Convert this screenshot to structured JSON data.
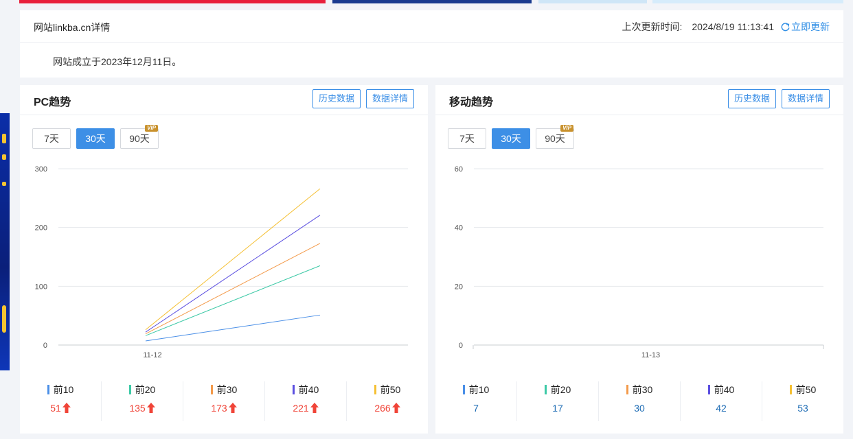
{
  "info": {
    "title": "网站linkba.cn详情",
    "update_label": "上次更新时间:",
    "update_time": "2024/8/19 11:13:41",
    "refresh_label": "立即更新",
    "founded_text": "网站成立于2023年12月11日。"
  },
  "pc": {
    "title": "PC趋势",
    "history_btn": "历史数据",
    "detail_btn": "数据详情",
    "ranges": [
      "7天",
      "30天",
      "90天"
    ],
    "active_range": "30天",
    "vip_badge": "VIP"
  },
  "mobile": {
    "title": "移动趋势",
    "history_btn": "历史数据",
    "detail_btn": "数据详情",
    "ranges": [
      "7天",
      "30天",
      "90天"
    ],
    "active_range": "30天",
    "vip_badge": "VIP"
  },
  "colors": {
    "前10": "#4a8fe7",
    "前20": "#3cc9a6",
    "前30": "#f39a4a",
    "前40": "#5b4fe0",
    "前50": "#f5c034"
  },
  "chart_data": [
    {
      "type": "line",
      "title": "PC趋势",
      "x": [
        "11-12"
      ],
      "ylim": [
        0,
        300
      ],
      "yticks": [
        0,
        100,
        200,
        300
      ],
      "grid": true,
      "series": [
        {
          "name": "前10",
          "values": [
            7,
            51
          ]
        },
        {
          "name": "前20",
          "values": [
            16,
            135
          ]
        },
        {
          "name": "前30",
          "values": [
            19,
            173
          ]
        },
        {
          "name": "前40",
          "values": [
            22,
            221
          ]
        },
        {
          "name": "前50",
          "values": [
            26,
            266
          ]
        }
      ],
      "legend_values": [
        {
          "name": "前10",
          "value": "51",
          "trend": "up"
        },
        {
          "name": "前20",
          "value": "135",
          "trend": "up"
        },
        {
          "name": "前30",
          "value": "173",
          "trend": "up"
        },
        {
          "name": "前40",
          "value": "221",
          "trend": "up"
        },
        {
          "name": "前50",
          "value": "266",
          "trend": "up"
        }
      ]
    },
    {
      "type": "line",
      "title": "移动趋势",
      "x": [
        "11-13"
      ],
      "ylim": [
        0,
        60
      ],
      "yticks": [
        0,
        20,
        40,
        60
      ],
      "grid": true,
      "series": [],
      "legend_values": [
        {
          "name": "前10",
          "value": "7",
          "trend": "none"
        },
        {
          "name": "前20",
          "value": "17",
          "trend": "none"
        },
        {
          "name": "前30",
          "value": "30",
          "trend": "none"
        },
        {
          "name": "前40",
          "value": "42",
          "trend": "none"
        },
        {
          "name": "前50",
          "value": "53",
          "trend": "none"
        }
      ]
    }
  ]
}
